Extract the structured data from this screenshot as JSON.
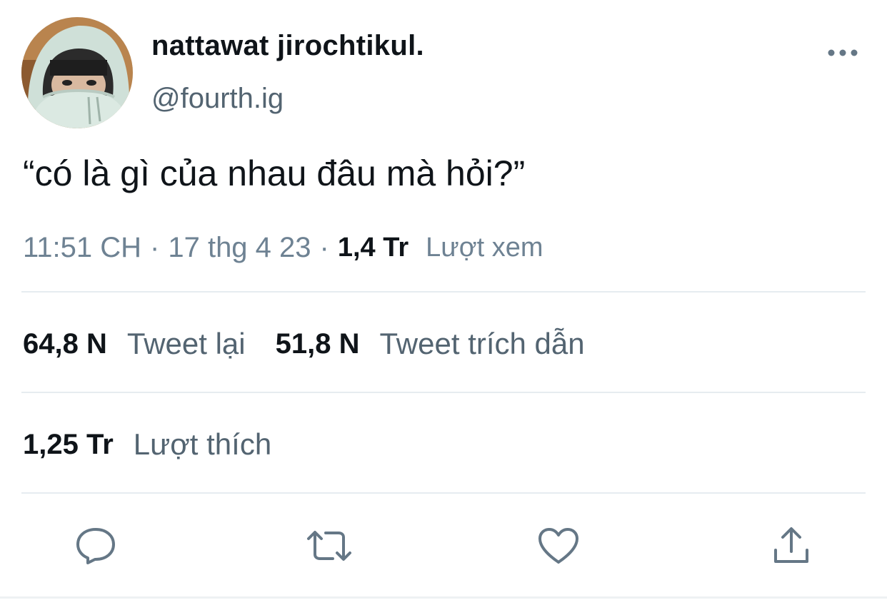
{
  "author": {
    "display_name": "nattawat jirochtikul.",
    "handle": "@fourth.ig"
  },
  "tweet": {
    "text": "“có là gì của nhau đâu mà hỏi?”",
    "time": "11:51 CH",
    "date": "17 thg 4 23",
    "separator": "·",
    "views_count": "1,4 Tr",
    "views_label": "Lượt xem"
  },
  "stats": {
    "retweets_count": "64,8 N",
    "retweets_label": "Tweet lại",
    "quotes_count": "51,8 N",
    "quotes_label": "Tweet trích dẫn",
    "likes_count": "1,25 Tr",
    "likes_label": "Lượt thích"
  },
  "actions": [
    "reply-icon",
    "retweet-icon",
    "like-icon",
    "share-icon"
  ],
  "colors": {
    "text_primary": "#0f1419",
    "text_secondary": "#536471",
    "icon": "#657786",
    "divider": "#e6ecf0"
  }
}
